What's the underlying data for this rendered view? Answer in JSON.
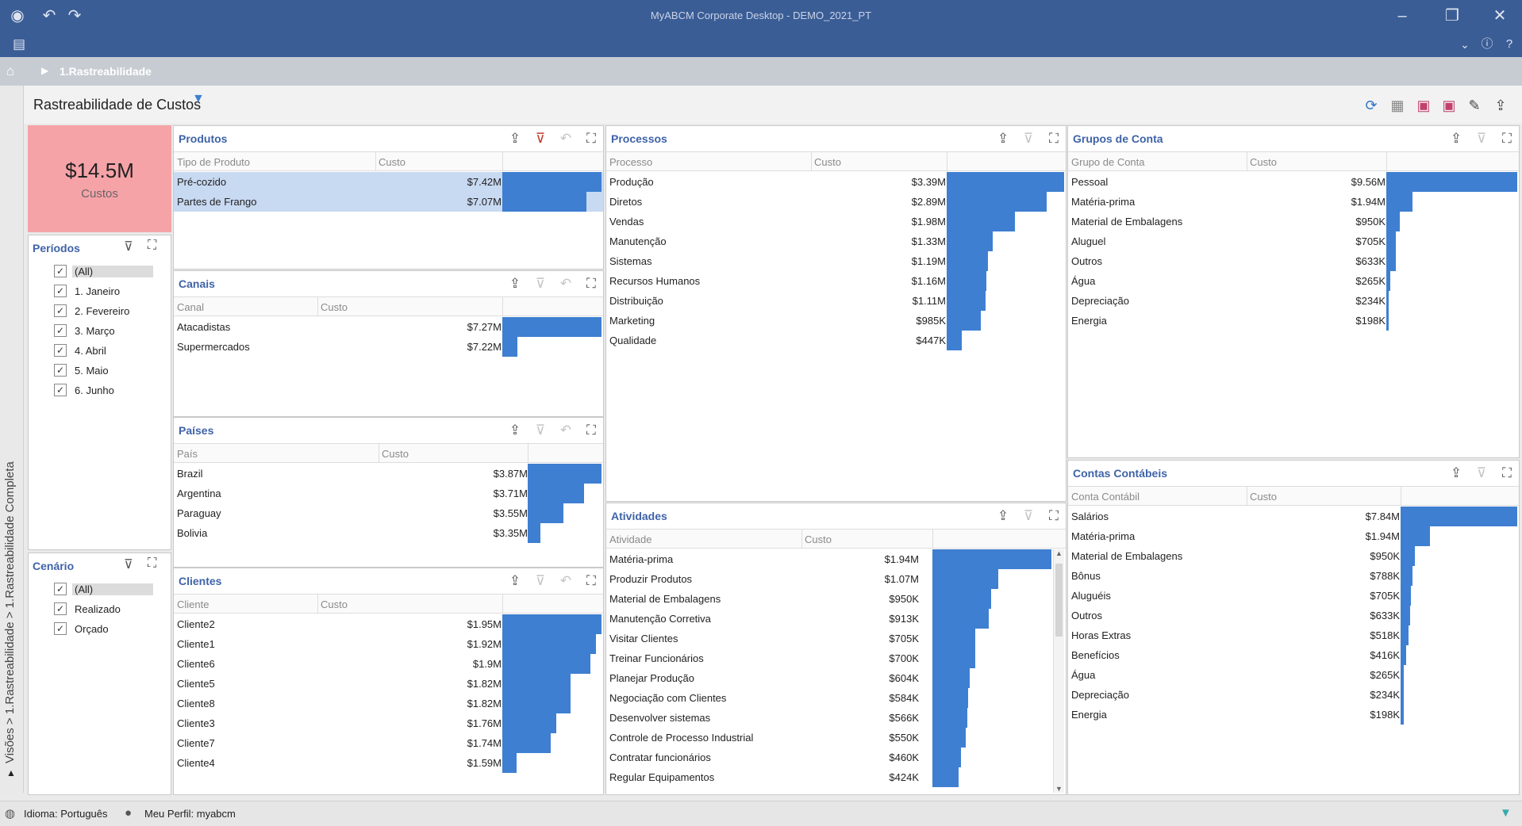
{
  "window": {
    "title": "MyABCM Corporate Desktop - DEMO_2021_PT"
  },
  "breadcrumb": {
    "label": "1.Rastreabilidade"
  },
  "view": {
    "title": "Rastreabilidade de Custos",
    "side_label": "Visões > 1.Rastreabilidade > 1.Rastreabilidade Completa"
  },
  "kpi": {
    "value": "$14.5M",
    "label": "Custos"
  },
  "periodos": {
    "title": "Períodos",
    "items": [
      "(All)",
      "1. Janeiro",
      "2. Fevereiro",
      "3. Março",
      "4. Abril",
      "5. Maio",
      "6. Junho"
    ]
  },
  "cenario": {
    "title": "Cenário",
    "items": [
      "(All)",
      "Realizado",
      "Orçado"
    ]
  },
  "produtos": {
    "title": "Produtos",
    "col1": "Tipo de Produto",
    "col2": "Custo",
    "rows": [
      [
        "Pré-cozido",
        "$7.42M",
        1
      ],
      [
        "Partes de Frango",
        "$7.07M",
        0.85
      ]
    ]
  },
  "canais": {
    "title": "Canais",
    "col1": "Canal",
    "col2": "Custo",
    "rows": [
      [
        "Atacadistas",
        "$7.27M",
        1
      ],
      [
        "Supermercados",
        "$7.22M",
        0.15
      ]
    ]
  },
  "paises": {
    "title": "Países",
    "col1": "País",
    "col2": "Custo",
    "rows": [
      [
        "Brazil",
        "$3.87M",
        1
      ],
      [
        "Argentina",
        "$3.71M",
        0.76
      ],
      [
        "Paraguay",
        "$3.55M",
        0.48
      ],
      [
        "Bolivia",
        "$3.35M",
        0.17
      ]
    ]
  },
  "clientes": {
    "title": "Clientes",
    "col1": "Cliente",
    "col2": "Custo",
    "rows": [
      [
        "Cliente2",
        "$1.95M",
        1
      ],
      [
        "Cliente1",
        "$1.92M",
        0.94
      ],
      [
        "Cliente6",
        "$1.9M",
        0.89
      ],
      [
        "Cliente5",
        "$1.82M",
        0.69
      ],
      [
        "Cliente8",
        "$1.82M",
        0.69
      ],
      [
        "Cliente3",
        "$1.76M",
        0.54
      ],
      [
        "Cliente7",
        "$1.74M",
        0.49
      ],
      [
        "Cliente4",
        "$1.59M",
        0.14
      ]
    ]
  },
  "processos": {
    "title": "Processos",
    "col1": "Processo",
    "col2": "Custo",
    "rows": [
      [
        "Produção",
        "$3.39M",
        1
      ],
      [
        "Diretos",
        "$2.89M",
        0.85
      ],
      [
        "Vendas",
        "$1.98M",
        0.58
      ],
      [
        "Manutenção",
        "$1.33M",
        0.39
      ],
      [
        "Sistemas",
        "$1.19M",
        0.35
      ],
      [
        "Recursos Humanos",
        "$1.16M",
        0.34
      ],
      [
        "Distribuição",
        "$1.11M",
        0.33
      ],
      [
        "Marketing",
        "$985K",
        0.29
      ],
      [
        "Qualidade",
        "$447K",
        0.13
      ]
    ]
  },
  "atividades": {
    "title": "Atividades",
    "col1": "Atividade",
    "col2": "Custo",
    "rows": [
      [
        "Matéria-prima",
        "$1.94M",
        1
      ],
      [
        "Produzir Produtos",
        "$1.07M",
        0.55
      ],
      [
        "Material de Embalagens",
        "$950K",
        0.49
      ],
      [
        "Manutenção Corretiva",
        "$913K",
        0.47
      ],
      [
        "Visitar Clientes",
        "$705K",
        0.36
      ],
      [
        "Treinar Funcionários",
        "$700K",
        0.36
      ],
      [
        "Planejar Produção",
        "$604K",
        0.31
      ],
      [
        "Negociação com Clientes",
        "$584K",
        0.3
      ],
      [
        "Desenvolver sistemas",
        "$566K",
        0.29
      ],
      [
        "Controle de Processo Industrial",
        "$550K",
        0.28
      ],
      [
        "Contratar funcionários",
        "$460K",
        0.24
      ],
      [
        "Regular Equipamentos",
        "$424K",
        0.22
      ]
    ]
  },
  "grupos": {
    "title": "Grupos de Conta",
    "col1": "Grupo de Conta",
    "col2": "Custo",
    "rows": [
      [
        "Pessoal",
        "$9.56M",
        1
      ],
      [
        "Matéria-prima",
        "$1.94M",
        0.2
      ],
      [
        "Material de Embalagens",
        "$950K",
        0.1
      ],
      [
        "Aluguel",
        "$705K",
        0.07
      ],
      [
        "Outros",
        "$633K",
        0.07
      ],
      [
        "Água",
        "$265K",
        0.03
      ],
      [
        "Depreciação",
        "$234K",
        0.02
      ],
      [
        "Energia",
        "$198K",
        0.02
      ]
    ]
  },
  "contas": {
    "title": "Contas Contábeis",
    "col1": "Conta Contábil",
    "col2": "Custo",
    "rows": [
      [
        "Salários",
        "$7.84M",
        1
      ],
      [
        "Matéria-prima",
        "$1.94M",
        0.25
      ],
      [
        "Material de Embalagens",
        "$950K",
        0.12
      ],
      [
        "Bônus",
        "$788K",
        0.1
      ],
      [
        "Aluguéis",
        "$705K",
        0.09
      ],
      [
        "Outros",
        "$633K",
        0.08
      ],
      [
        "Horas Extras",
        "$518K",
        0.07
      ],
      [
        "Benefícios",
        "$416K",
        0.05
      ],
      [
        "Água",
        "$265K",
        0.03
      ],
      [
        "Depreciação",
        "$234K",
        0.03
      ],
      [
        "Energia",
        "$198K",
        0.03
      ]
    ]
  },
  "status": {
    "language": "Idioma: Português",
    "profile": "Meu Perfil: myabcm"
  }
}
